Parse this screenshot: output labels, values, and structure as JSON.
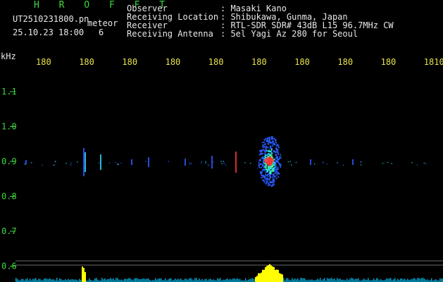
{
  "header": {
    "title": "H R O F F T",
    "file_name": "UT2510231800.pn",
    "tag": "meteor",
    "datetime": "25.10.23 18:00",
    "count": "6",
    "info": [
      {
        "label": "Observer",
        "value": ": Masaki Kano"
      },
      {
        "label": "Receiving Location",
        "value": ": Shibukawa, Gunma, Japan"
      },
      {
        "label": "Receiver",
        "value": ": RTL-SDR SDR# 43dB L15 96.7MHz CW"
      },
      {
        "label": "Receiving Antenna",
        "value": ": 5el Yagi Az 280 for Seoul"
      }
    ]
  },
  "spectrogram": {
    "y_unit": "kHz",
    "y_ticks": [
      "1.1",
      "1.0",
      "0.9",
      "0.8",
      "0.7",
      "0.6"
    ],
    "x_ticks": [
      "180",
      "180",
      "180",
      "180",
      "180",
      "180",
      "180",
      "180",
      "180",
      "1810"
    ],
    "colors": {
      "text_green": "#3fd63f",
      "text_yellow": "#e8e24a",
      "text_white": "#e8e8e8",
      "grid": "#555555",
      "echo_blue": "#2a5cff",
      "echo_cyan": "#2fd8ff",
      "echo_red": "#ff3030",
      "bar_yellow": "#ffff00",
      "bar_cyan": "#00c8ff"
    }
  }
}
